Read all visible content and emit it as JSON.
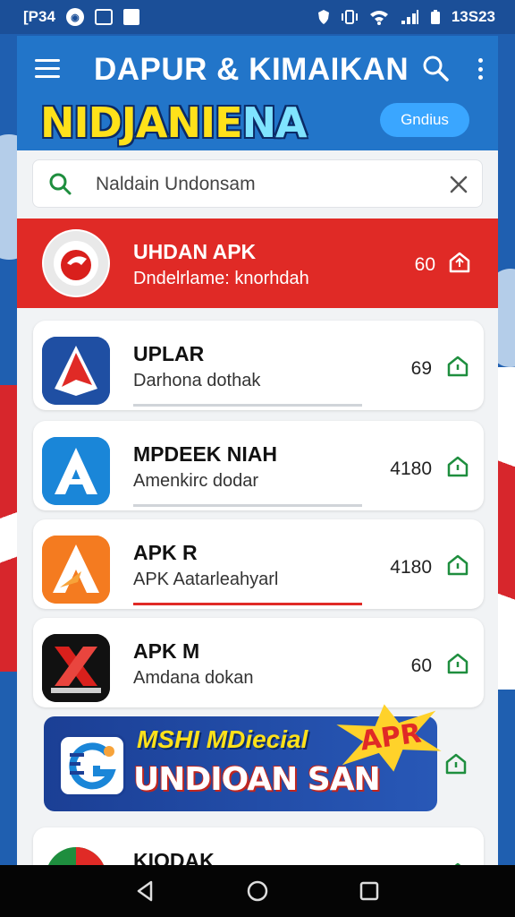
{
  "status_bar": {
    "left_text": "[P34",
    "time": "13S23"
  },
  "header": {
    "title": "DAPUR & KIMAIKAN",
    "banner_title_main": "NIDJANIE",
    "banner_title_accent": "NA",
    "badge": "Gndius"
  },
  "search": {
    "value": "Naldain Undonsam"
  },
  "apps": [
    {
      "name": "UHDAN APK",
      "subtitle": "Dndelrlame: knorhdah",
      "count": "60",
      "icon": "circle-logo-icon",
      "featured": true
    },
    {
      "name": "UPLAR",
      "subtitle": "Darhona dothak",
      "count": "69",
      "icon": "red-arrow-logo-icon",
      "progress": 0
    },
    {
      "name": "MPDEEK NIAH",
      "subtitle": "Amenkirc dodar",
      "count": "4180",
      "icon": "blue-a-logo-icon",
      "progress": 0
    },
    {
      "name": "APK R",
      "subtitle": "APK   Aatarleahyarl",
      "count": "4180",
      "icon": "orange-a-logo-icon",
      "progress": 1.0
    },
    {
      "name": "APK M",
      "subtitle": "Amdana dokan",
      "count": "60",
      "icon": "black-x-logo-icon"
    },
    {
      "name": "KIODAK",
      "subtitle": "",
      "count": "",
      "icon": "chrome-like-logo-icon"
    }
  ],
  "promo": {
    "line1": "MSHI MDiecial",
    "line2": "UNDIOAN SAN",
    "sticker": "APR"
  },
  "colors": {
    "header_blue": "#2275c9",
    "featured_red": "#e02a26",
    "install_green": "#1e8e3e",
    "banner_yellow": "#ffe11a"
  }
}
